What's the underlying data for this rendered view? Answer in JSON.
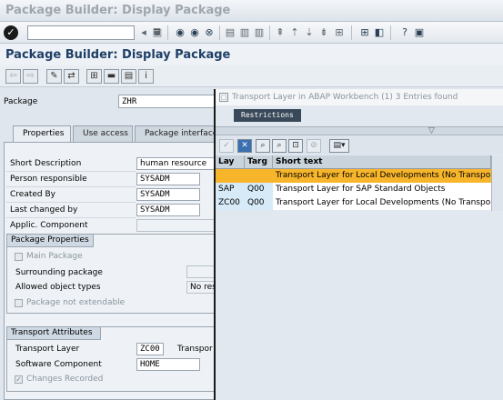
{
  "window": {
    "title": "Package Builder: Display Package"
  },
  "std_toolbar": {
    "command_field_value": ""
  },
  "app": {
    "title": "Package Builder: Display Package"
  },
  "package": {
    "label": "Package",
    "value": "ZHR"
  },
  "tabs": [
    {
      "label": "Properties",
      "active": true
    },
    {
      "label": "Use access",
      "active": false
    },
    {
      "label": "Package interface",
      "active": false
    }
  ],
  "properties": {
    "short_description": {
      "label": "Short Description",
      "value": "human resource"
    },
    "person_responsible": {
      "label": "Person responsible",
      "value": "SYSADM"
    },
    "created_by": {
      "label": "Created By",
      "value": "SYSADM"
    },
    "last_changed_by": {
      "label": "Last changed by",
      "value": "SYSADM"
    },
    "applic_component": {
      "label": "Applic. Component",
      "value": ""
    }
  },
  "package_properties": {
    "header": "Package Properties",
    "main_package": {
      "label": "Main Package",
      "checked": false
    },
    "surrounding_package": {
      "label": "Surrounding package",
      "value": ""
    },
    "allowed_object_types": {
      "label": "Allowed object types",
      "value": "No res"
    },
    "not_extendable": {
      "label": "Package not extendable",
      "checked": false
    }
  },
  "transport_attributes": {
    "header": "Transport Attributes",
    "transport_layer": {
      "label": "Transport Layer",
      "value": "ZC00",
      "trailing": "Transpor"
    },
    "software_component": {
      "label": "Software Component",
      "value": "HOME"
    },
    "changes_recorded": {
      "label": "Changes Recorded",
      "checked": true
    }
  },
  "popup": {
    "title": "Transport Layer in ABAP Workbench (1)    3 Entries found",
    "tab_label": "Restrictions",
    "columns": [
      "Lay",
      "Targ",
      "Short text"
    ],
    "rows": [
      {
        "layer": "",
        "target": "",
        "text": "Transport Layer for Local Developments (No Transport)",
        "selected": true
      },
      {
        "layer": "SAP",
        "target": "Q00",
        "text": "Transport Layer for SAP Standard Objects",
        "selected": false
      },
      {
        "layer": "ZC00",
        "target": "Q00",
        "text": "Transport Layer for Local Developments (No Transport)",
        "selected": false
      }
    ]
  },
  "icons": {
    "ok": "enter-check-icon",
    "save": "save-icon",
    "back": "back-icon",
    "exit": "exit-icon",
    "cancel": "cancel-icon",
    "print": "print-icon",
    "find": "find-icon",
    "help": "help-icon"
  }
}
